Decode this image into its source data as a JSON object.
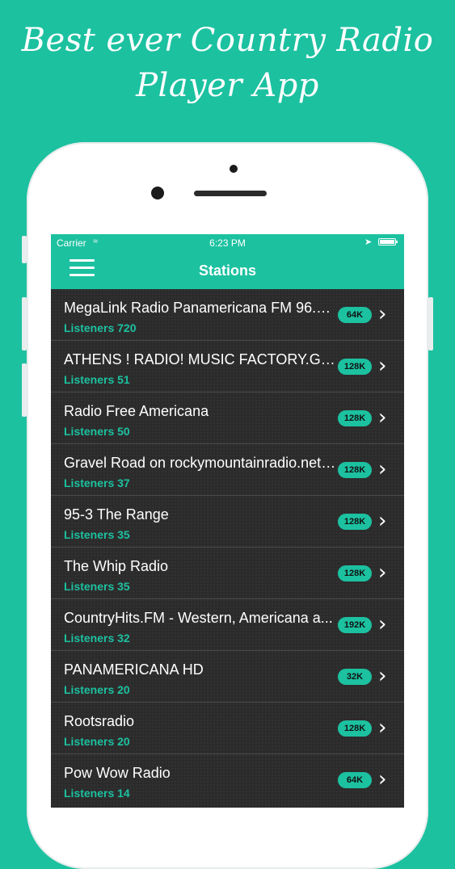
{
  "headline": {
    "line1": "Best ever Country Radio",
    "line2": "Player App"
  },
  "status_bar": {
    "carrier": "Carrier",
    "wifi_icon": "wifi-icon",
    "time": "6:23 PM",
    "location_icon": "location-arrow-icon",
    "battery_icon": "battery-icon"
  },
  "nav": {
    "title": "Stations",
    "menu_icon": "hamburger-menu-icon"
  },
  "colors": {
    "accent": "#1cc1a0",
    "list_bg": "#2b2b2b"
  },
  "stations": [
    {
      "name": "MegaLink Radio Panamericana FM 96.1...",
      "listeners": "Listeners 720",
      "bitrate": "64K"
    },
    {
      "name": "ATHENS ! RADIO! MUSIC FACTORY.GR !...",
      "listeners": "Listeners 51",
      "bitrate": "128K"
    },
    {
      "name": "Radio Free Americana",
      "listeners": "Listeners 50",
      "bitrate": "128K"
    },
    {
      "name": "Gravel Road on rockymountainradio.net:...",
      "listeners": "Listeners 37",
      "bitrate": "128K"
    },
    {
      "name": "95-3 The Range",
      "listeners": "Listeners 35",
      "bitrate": "128K"
    },
    {
      "name": "The Whip Radio",
      "listeners": "Listeners 35",
      "bitrate": "128K"
    },
    {
      "name": "CountryHits.FM - Western, Americana a...",
      "listeners": "Listeners 32",
      "bitrate": "192K"
    },
    {
      "name": "PANAMERICANA HD",
      "listeners": "Listeners 20",
      "bitrate": "32K"
    },
    {
      "name": "Rootsradio",
      "listeners": "Listeners 20",
      "bitrate": "128K"
    },
    {
      "name": "Pow Wow Radio",
      "listeners": "Listeners 14",
      "bitrate": "64K"
    }
  ]
}
